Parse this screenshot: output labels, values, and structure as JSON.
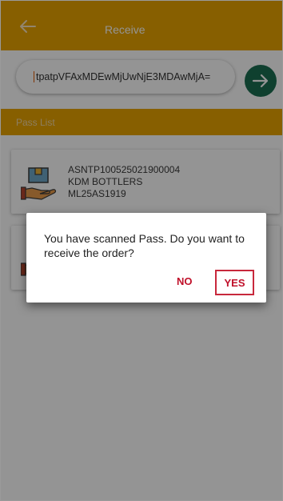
{
  "appbar": {
    "title": "Receive",
    "back_icon": "arrow-left-icon",
    "color": "#e8a400"
  },
  "search": {
    "value": "tpatpVFAxMDEwMjUwNjE3MDAwMjA=",
    "submit_icon": "arrow-right-icon",
    "submit_color": "#1b6e52"
  },
  "section": {
    "label": "Pass List"
  },
  "passes": [
    {
      "icon": "package-hand-icon",
      "number": "ASNTP100525021900004",
      "company": "KDM BOTTLERS",
      "vehicle": "ML25AS1919"
    },
    {
      "icon": "package-hand-icon"
    }
  ],
  "dialog": {
    "message": "You have scanned Pass. Do you want to receive the order?",
    "no_label": "NO",
    "yes_label": "YES",
    "accent": "#c0102a"
  }
}
